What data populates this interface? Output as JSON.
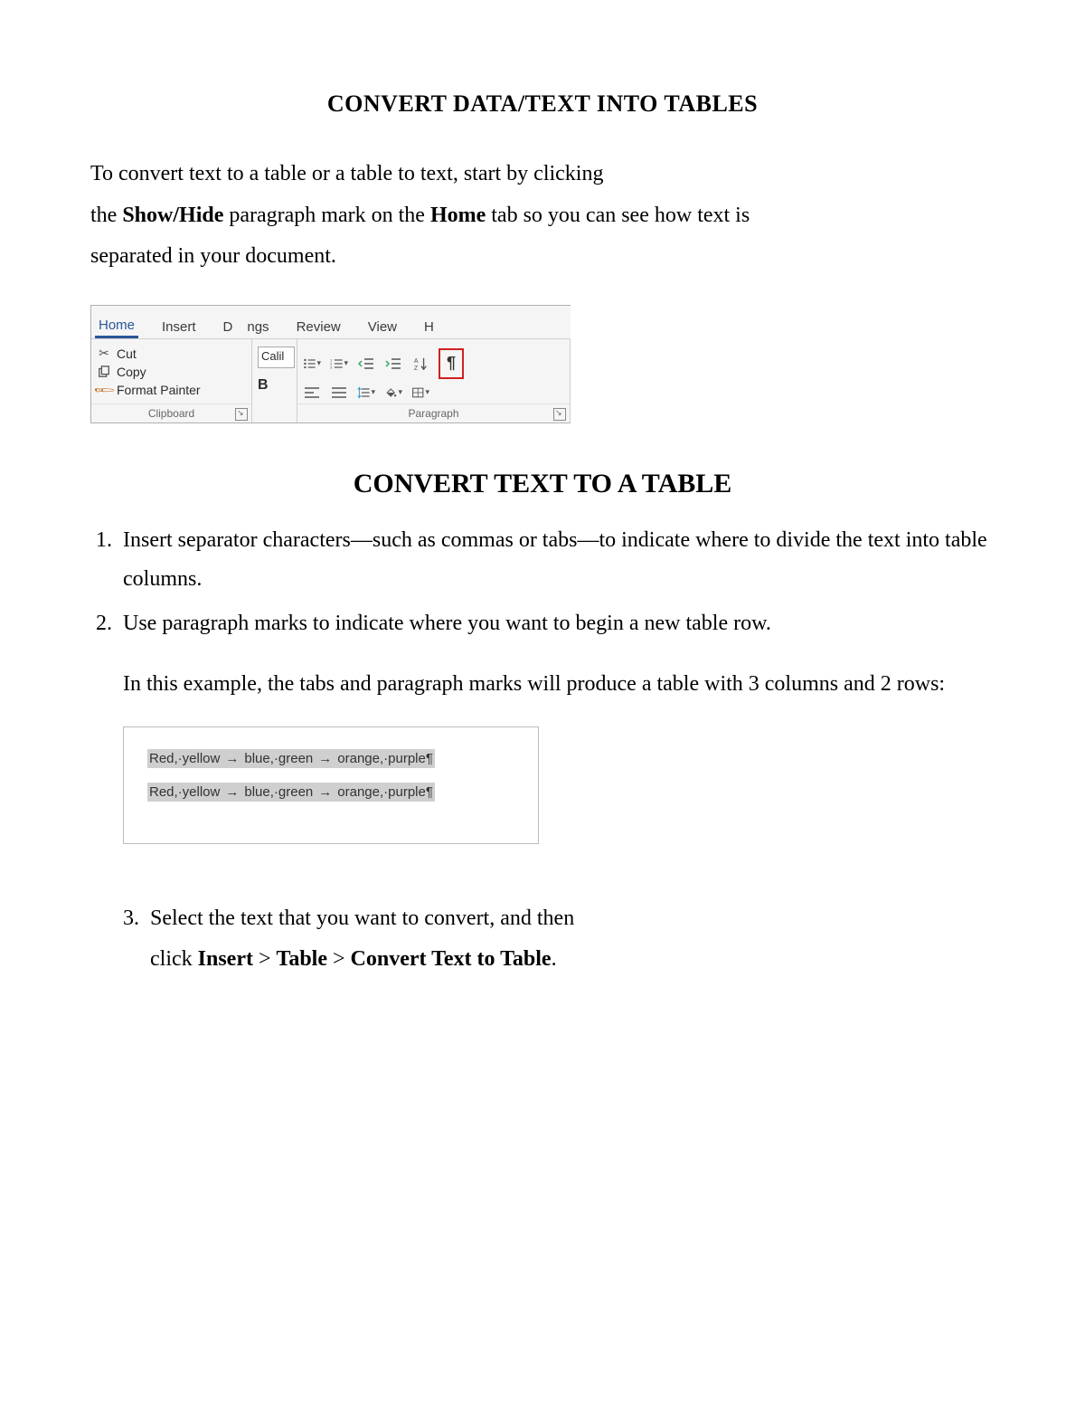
{
  "title": "CONVERT DATA/TEXT INTO TABLES",
  "intro": {
    "l1": "To convert text to a table or a table to text, start by clicking",
    "l2a": "the ",
    "showhide": "Show/Hide",
    "l2b": " paragraph mark on the ",
    "home": "Home",
    "l2c": " tab so you can see how text is",
    "l3": "separated in your document."
  },
  "ribbon": {
    "tabs": {
      "home": "Home",
      "insert": "Insert",
      "d": "D",
      "ngs": "ngs",
      "review": "Review",
      "view": "View",
      "h": "H"
    },
    "clipboard": {
      "title": "Clipboard",
      "cut": "Cut",
      "copy": "Copy",
      "format": "Format Painter"
    },
    "font": {
      "name": "Calil",
      "bold": "B"
    },
    "paragraph": {
      "title": "Paragraph",
      "sort_a": "A",
      "sort_z": "Z",
      "pilcrow": "¶"
    }
  },
  "section_heading": "CONVERT TEXT TO A TABLE",
  "list_items": [
    "Insert separator characters—such as commas or tabs—to indicate where to divide the text into table columns.",
    "Use paragraph marks to indicate where you want to begin a new table row."
  ],
  "example_intro": "In this example, the tabs and paragraph marks will produce a table with 3 columns and 2 rows:",
  "example": {
    "c1": "Red,·yellow",
    "c2": "blue,·green",
    "c3": "orange,·purple¶"
  },
  "step3": {
    "num": "3.",
    "a": "Select the text that you want to convert, and then",
    "b1": "click ",
    "insert": "Insert",
    "gt1": " > ",
    "table": "Table",
    "gt2": " > ",
    "ctt": "Convert Text to Table",
    "dot": "."
  }
}
